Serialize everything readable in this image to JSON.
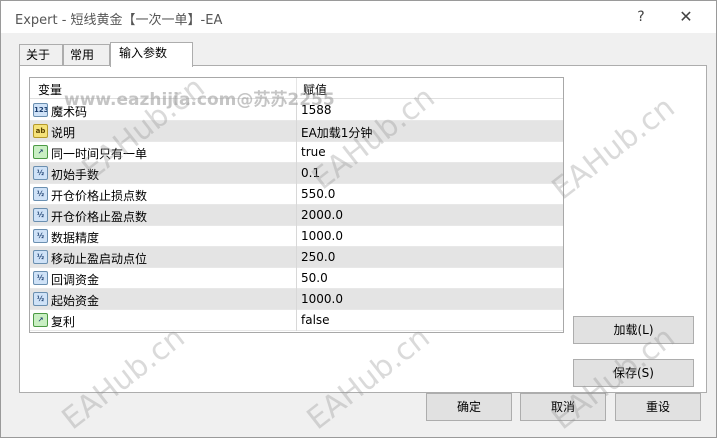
{
  "window": {
    "title": "Expert - 短线黄金【一次一单】-EA",
    "help_glyph": "?",
    "close_glyph": "✕"
  },
  "tabs": [
    {
      "label": "关于",
      "active": false
    },
    {
      "label": "常用",
      "active": false
    },
    {
      "label": "输入参数",
      "active": true
    }
  ],
  "grid": {
    "headers": {
      "variable": "变量",
      "value": "赋值"
    },
    "rows": [
      {
        "icon": "integer-icon",
        "icon_text": "123",
        "name": "魔术码",
        "value": "1588"
      },
      {
        "icon": "string-icon",
        "icon_text": "ab",
        "name": "说明",
        "value": "EA加载1分钟"
      },
      {
        "icon": "boolean-icon",
        "icon_text": "↗",
        "name": "同一时间只有一单",
        "value": "true"
      },
      {
        "icon": "double-icon",
        "icon_text": "½",
        "name": "初始手数",
        "value": "0.1"
      },
      {
        "icon": "double-icon",
        "icon_text": "½",
        "name": "开仓价格止损点数",
        "value": "550.0"
      },
      {
        "icon": "double-icon",
        "icon_text": "½",
        "name": "开仓价格止盈点数",
        "value": "2000.0"
      },
      {
        "icon": "double-icon",
        "icon_text": "½",
        "name": "数据精度",
        "value": "1000.0"
      },
      {
        "icon": "double-icon",
        "icon_text": "½",
        "name": "移动止盈启动点位",
        "value": "250.0"
      },
      {
        "icon": "double-icon",
        "icon_text": "½",
        "name": "回调资金",
        "value": "50.0"
      },
      {
        "icon": "double-icon",
        "icon_text": "½",
        "name": "起始资金",
        "value": "1000.0"
      },
      {
        "icon": "boolean-icon",
        "icon_text": "↗",
        "name": "复利",
        "value": "false"
      }
    ]
  },
  "buttons": {
    "load": "加载(L)",
    "save": "保存(S)",
    "ok": "确定",
    "cancel": "取消",
    "reset": "重设"
  },
  "watermarks": {
    "top": "www.eazhijia.com@苏苏2255",
    "repeat": "EAHub.cn"
  }
}
